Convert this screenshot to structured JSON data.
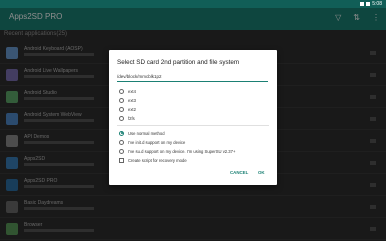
{
  "status": {
    "time": "5:08"
  },
  "appbar": {
    "title": "Apps2SD PRO"
  },
  "list": {
    "header": "Recent applications(25)",
    "rows": [
      {
        "label": "Android Keyboard (AOSP)",
        "color": "#6b9bd1"
      },
      {
        "label": "Android Live Wallpapers",
        "color": "#7b6fb1"
      },
      {
        "label": "Android Studio",
        "color": "#5ea86a"
      },
      {
        "label": "Android System WebView",
        "color": "#4f89c9"
      },
      {
        "label": "API Demos",
        "color": "#8a8a8a"
      },
      {
        "label": "Apps2SD",
        "color": "#3a7fb8"
      },
      {
        "label": "Apps2SD PRO",
        "color": "#2c6fa5"
      },
      {
        "label": "Basic Daydreams",
        "color": "#6a6a6a"
      },
      {
        "label": "Browser",
        "color": "#5a9a5a"
      }
    ]
  },
  "dialog": {
    "title": "Select SD card 2nd partition and file system",
    "path_value": "/dev/block/mmcblk1p2",
    "filesystems": [
      {
        "label": "ext4",
        "selected": false
      },
      {
        "label": "ext3",
        "selected": false
      },
      {
        "label": "ext2",
        "selected": false
      },
      {
        "label": "f2fs",
        "selected": false
      }
    ],
    "methods": [
      {
        "label": "Use normal method",
        "selected": true
      },
      {
        "label": "I've init.d support on my device",
        "selected": false
      },
      {
        "label": "I've su.d support on my device. I'm using SuperSU v2.37+",
        "selected": false
      }
    ],
    "checkbox_label": "Create script for recovery mode",
    "cancel": "CANCEL",
    "ok": "OK"
  }
}
